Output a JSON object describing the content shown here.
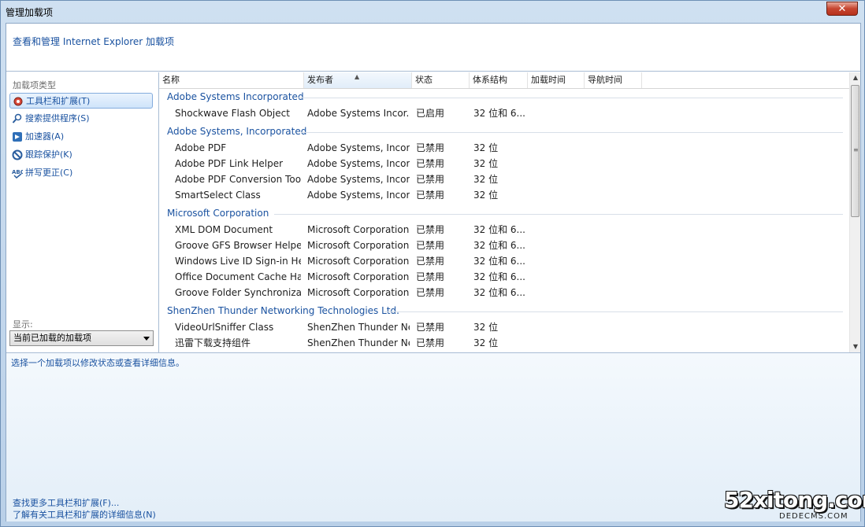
{
  "window": {
    "title": "管理加载项",
    "close_label": "✕"
  },
  "header": {
    "text": "查看和管理 Internet Explorer 加载项"
  },
  "sidebar": {
    "title": "加载项类型",
    "items": [
      {
        "label": "工具栏和扩展(T)",
        "icon": "gear-icon",
        "selected": true
      },
      {
        "label": "搜索提供程序(S)",
        "icon": "search-icon",
        "selected": false
      },
      {
        "label": "加速器(A)",
        "icon": "accelerator-icon",
        "selected": false
      },
      {
        "label": "跟踪保护(K)",
        "icon": "block-icon",
        "selected": false
      },
      {
        "label": "拼写更正(C)",
        "icon": "spellcheck-icon",
        "selected": false
      }
    ],
    "show_label": "显示:",
    "show_value": "当前已加载的加载项"
  },
  "columns": [
    "名称",
    "发布者",
    "状态",
    "体系结构",
    "加载时间",
    "导航时间"
  ],
  "groups": [
    {
      "name": "Adobe Systems Incorporated",
      "rows": [
        {
          "name": "Shockwave Flash Object",
          "publisher": "Adobe Systems Incor...",
          "status": "已启用",
          "arch": "32 位和 6..."
        }
      ]
    },
    {
      "name": "Adobe Systems, Incorporated",
      "rows": [
        {
          "name": "Adobe PDF",
          "publisher": "Adobe Systems, Incor...",
          "status": "已禁用",
          "arch": "32 位"
        },
        {
          "name": "Adobe PDF Link Helper",
          "publisher": "Adobe Systems, Incor...",
          "status": "已禁用",
          "arch": "32 位"
        },
        {
          "name": "Adobe PDF Conversion Tool...",
          "publisher": "Adobe Systems, Incor...",
          "status": "已禁用",
          "arch": "32 位"
        },
        {
          "name": "SmartSelect Class",
          "publisher": "Adobe Systems, Incor...",
          "status": "已禁用",
          "arch": "32 位"
        }
      ]
    },
    {
      "name": "Microsoft Corporation",
      "rows": [
        {
          "name": "XML DOM Document",
          "publisher": "Microsoft Corporation",
          "status": "已禁用",
          "arch": "32 位和 6..."
        },
        {
          "name": "Groove GFS Browser Helper",
          "publisher": "Microsoft Corporation",
          "status": "已禁用",
          "arch": "32 位和 6..."
        },
        {
          "name": "Windows Live ID Sign-in Hel...",
          "publisher": "Microsoft Corporation",
          "status": "已禁用",
          "arch": "32 位和 6..."
        },
        {
          "name": "Office Document Cache Han...",
          "publisher": "Microsoft Corporation",
          "status": "已禁用",
          "arch": "32 位和 6..."
        },
        {
          "name": "Groove Folder Synchronizati...",
          "publisher": "Microsoft Corporation",
          "status": "已禁用",
          "arch": "32 位和 6..."
        }
      ]
    },
    {
      "name": "ShenZhen Thunder Networking Technologies Ltd.",
      "rows": [
        {
          "name": "VideoUrlSniffer Class",
          "publisher": "ShenZhen Thunder Ne...",
          "status": "已禁用",
          "arch": "32 位"
        },
        {
          "name": "迅雷下载支持组件",
          "publisher": "ShenZhen Thunder Ne...",
          "status": "已禁用",
          "arch": "32 位"
        }
      ]
    }
  ],
  "details": {
    "text": "选择一个加载项以修改状态或查看详细信息。"
  },
  "links": [
    "查找更多工具栏和扩展(F)...",
    "了解有关工具栏和扩展的详细信息(N)"
  ],
  "watermark": {
    "main": "52xitong.com",
    "sub": "DEDECMS.COM"
  },
  "colors": {
    "link": "#1a52a0",
    "group": "#1a52a0",
    "close": "#c6452f"
  }
}
